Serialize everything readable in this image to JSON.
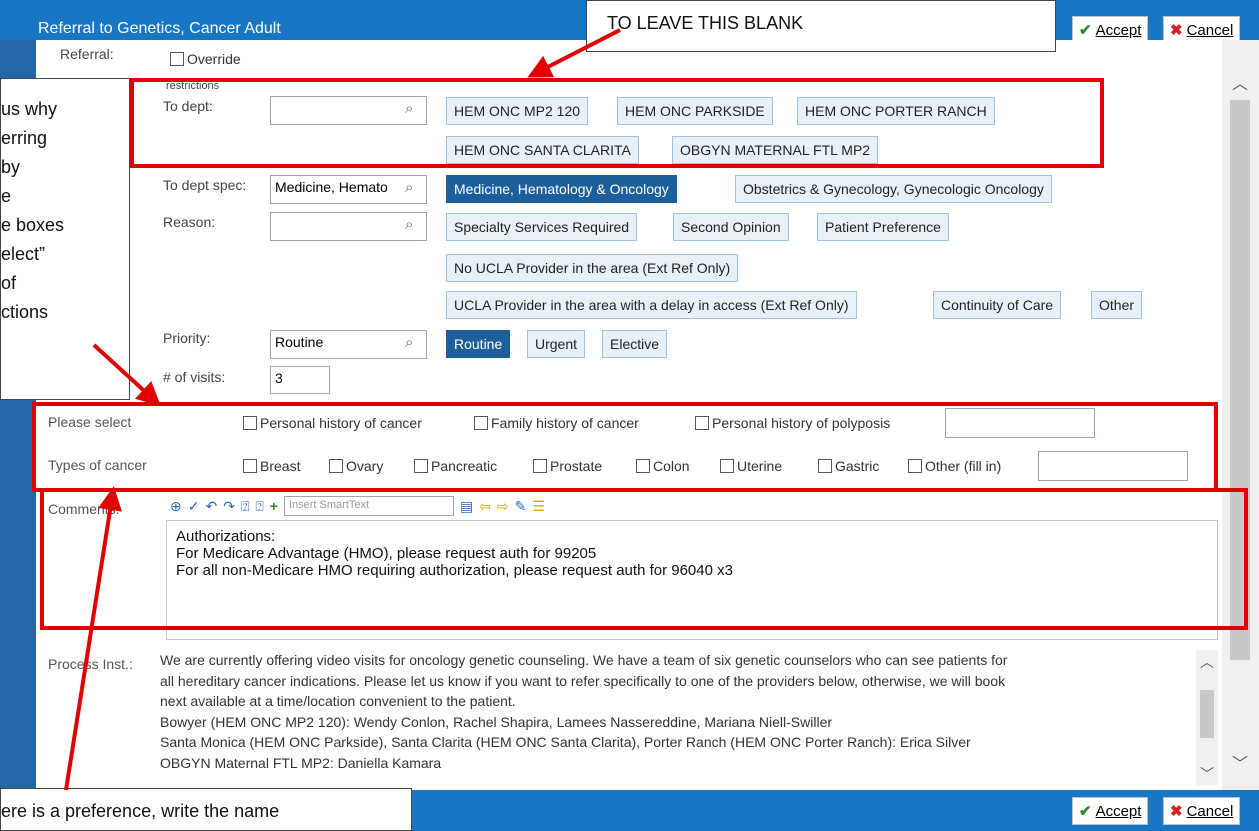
{
  "window": {
    "title": "Referral to Genetics, Cancer Adult",
    "accept_label": "Accept",
    "cancel_label": "Cancel"
  },
  "referral": {
    "label": "Referral:",
    "override_label": "Override",
    "restrictions_label": "restrictions"
  },
  "to_dept": {
    "label": "To dept:",
    "value": "",
    "options": [
      "HEM ONC MP2 120",
      "HEM ONC PARKSIDE",
      "HEM ONC PORTER RANCH",
      "HEM ONC SANTA CLARITA",
      "OBGYN MATERNAL FTL MP2"
    ]
  },
  "to_dept_spec": {
    "label": "To dept spec:",
    "value": "Medicine, Hemato",
    "options": [
      "Medicine, Hematology & Oncology",
      "Obstetrics & Gynecology, Gynecologic Oncology"
    ],
    "selected": "Medicine, Hematology & Oncology"
  },
  "reason": {
    "label": "Reason:",
    "value": "",
    "options": [
      "Specialty Services Required",
      "Second Opinion",
      "Patient Preference",
      "No UCLA Provider in the area (Ext Ref Only)",
      "UCLA Provider in the area with a delay in access (Ext Ref Only)",
      "Continuity of Care",
      "Other"
    ]
  },
  "priority": {
    "label": "Priority:",
    "value": "Routine",
    "options": [
      "Routine",
      "Urgent",
      "Elective"
    ],
    "selected": "Routine"
  },
  "visits": {
    "label": "# of visits:",
    "value": "3"
  },
  "please_select": {
    "label": "Please select",
    "options": [
      "Personal history of cancer",
      "Family history of cancer",
      "Personal history of polyposis"
    ]
  },
  "types_of_cancer": {
    "label": "Types of cancer",
    "options": [
      "Breast",
      "Ovary",
      "Pancreatic",
      "Prostate",
      "Colon",
      "Uterine",
      "Gastric",
      "Other (fill in)"
    ]
  },
  "comments": {
    "label": "Comments:",
    "smarttext_placeholder": "Insert SmartText",
    "lines": [
      "Authorizations:",
      "For Medicare Advantage (HMO), please request auth for 99205",
      "For all non-Medicare HMO requiring authorization, please request auth for 96040 x3"
    ]
  },
  "process_inst": {
    "label": "Process Inst.:",
    "lines": [
      "We are currently offering video visits for oncology genetic counseling. We have a team of six genetic counselors who can see patients for",
      "all hereditary cancer indications. Please let us know if you want to refer specifically to one of the providers below, otherwise, we will book",
      "next available at a time/location convenient to the patient.",
      "Bowyer (HEM ONC MP2 120): Wendy Conlon, Rachel Shapira, Lamees Nassereddine, Mariana Niell-Swiller",
      "Santa Monica (HEM ONC Parkside), Santa Clarita (HEM ONC Santa Clarita), Porter Ranch (HEM ONC Porter Ranch): Erica Silver",
      "OBGYN Maternal FTL MP2: Daniella Kamara"
    ]
  },
  "annotations": {
    "top_callout": "TO LEAVE THIS BLANK",
    "left_callout_lines": [
      "us why",
      "erring",
      "by",
      "e",
      "e boxes",
      "elect”",
      "of",
      "ctions"
    ],
    "bottom_callout": "ere is a preference, write the name",
    "highlight_color": "#e00000"
  },
  "colors": {
    "titlebar": "#1877c5",
    "selected_pill": "#1c5f9a"
  }
}
